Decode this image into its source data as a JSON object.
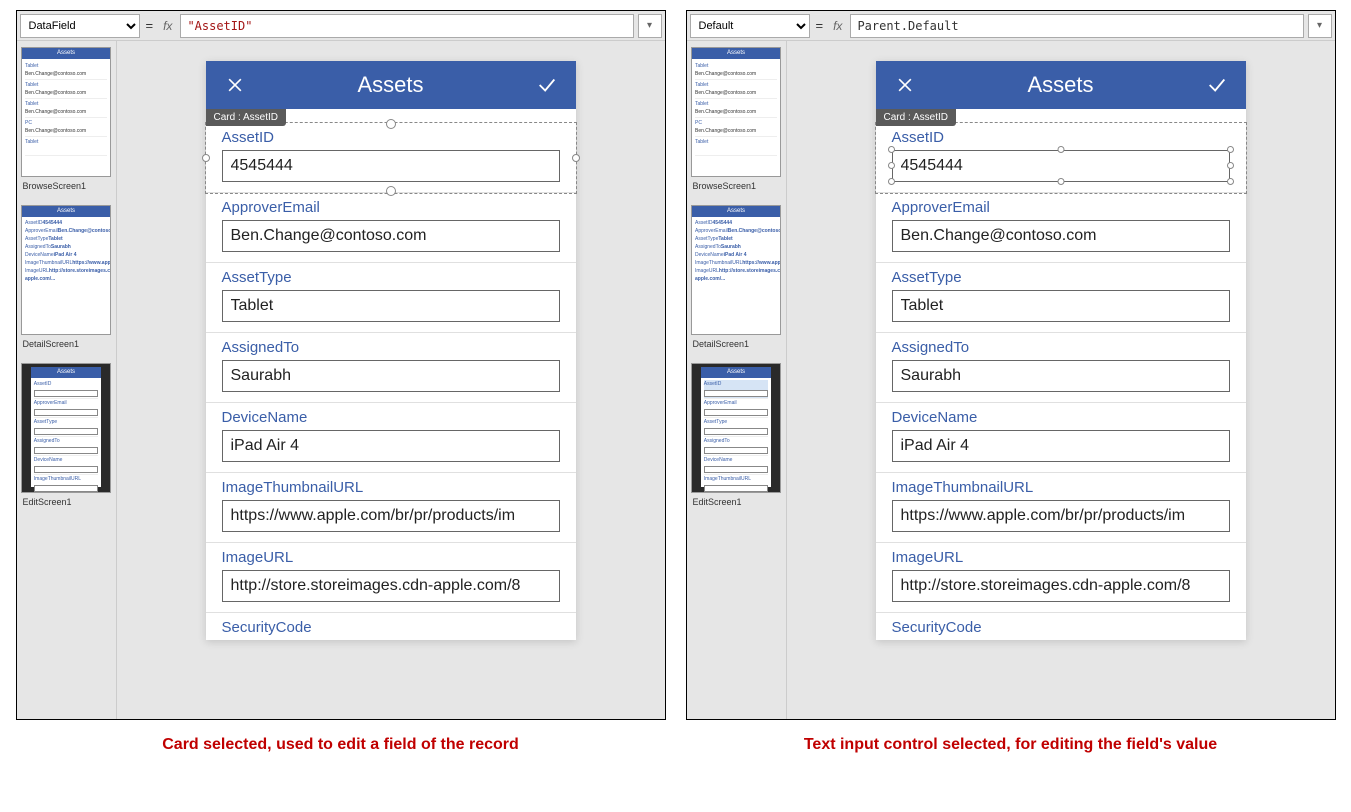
{
  "left": {
    "property": "DataField",
    "formula": "\"AssetID\"",
    "caption": "Card selected, used to edit a field of the record",
    "cardTag": "Card : AssetID",
    "thumbs": {
      "browse": "BrowseScreen1",
      "detail": "DetailScreen1",
      "edit": "EditScreen1",
      "title": "Assets"
    }
  },
  "right": {
    "property": "Default",
    "formula": "Parent.Default",
    "caption": "Text input control selected, for editing the field's value",
    "cardTag": "Card : AssetID",
    "thumbs": {
      "browse": "BrowseScreen1",
      "detail": "DetailScreen1",
      "edit": "EditScreen1",
      "title": "Assets"
    }
  },
  "app": {
    "title": "Assets",
    "fields": [
      {
        "label": "AssetID",
        "value": "4545444"
      },
      {
        "label": "ApproverEmail",
        "value": "Ben.Change@contoso.com"
      },
      {
        "label": "AssetType",
        "value": "Tablet"
      },
      {
        "label": "AssignedTo",
        "value": "Saurabh"
      },
      {
        "label": "DeviceName",
        "value": "iPad Air 4"
      },
      {
        "label": "ImageThumbnailURL",
        "value": "https://www.apple.com/br/pr/products/im"
      },
      {
        "label": "ImageURL",
        "value": "http://store.storeimages.cdn-apple.com/8"
      },
      {
        "label": "SecurityCode",
        "value": ""
      }
    ]
  }
}
